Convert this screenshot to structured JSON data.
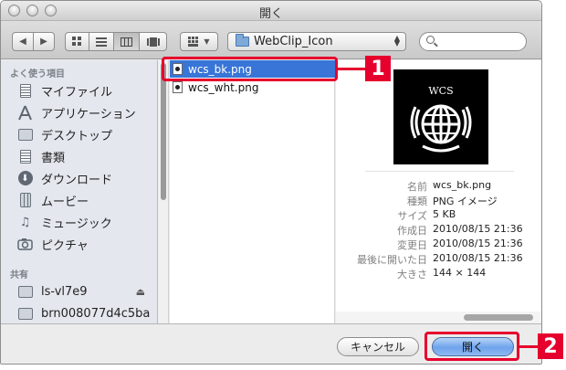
{
  "window": {
    "title": "開く"
  },
  "toolbar": {
    "back_icon": "back-arrow-icon",
    "forward_icon": "forward-arrow-icon",
    "view_modes": [
      "icon-view-icon",
      "list-view-icon",
      "column-view-icon",
      "coverflow-view-icon"
    ],
    "active_view": "column-view-icon",
    "arrange_icon": "arrange-grid-icon",
    "path": "WebClip_Icon",
    "search_placeholder": ""
  },
  "sidebar": {
    "favorites_heading": "よく使う項目",
    "favorites": [
      {
        "label": "マイファイル",
        "icon": "all-files-icon"
      },
      {
        "label": "アプリケーション",
        "icon": "applications-icon"
      },
      {
        "label": "デスクトップ",
        "icon": "desktop-icon"
      },
      {
        "label": "書類",
        "icon": "documents-icon"
      },
      {
        "label": "ダウンロード",
        "icon": "downloads-icon"
      },
      {
        "label": "ムービー",
        "icon": "movies-icon"
      },
      {
        "label": "ミュージック",
        "icon": "music-icon"
      },
      {
        "label": "ピクチャ",
        "icon": "pictures-icon"
      }
    ],
    "shared_heading": "共有",
    "shared": [
      {
        "label": "ls-vl7e9",
        "icon": "network-computer-icon",
        "eject": true
      },
      {
        "label": "brn008077d4c5ba",
        "icon": "network-computer-icon",
        "eject": false
      }
    ]
  },
  "files": [
    {
      "name": "wcs_bk.png",
      "selected": true
    },
    {
      "name": "wcs_wht.png",
      "selected": false
    }
  ],
  "preview": {
    "image_text": "WCS",
    "info": [
      {
        "key": "名前",
        "value": "wcs_bk.png"
      },
      {
        "key": "種類",
        "value": "PNG イメージ"
      },
      {
        "key": "サイズ",
        "value": "5 KB"
      },
      {
        "key": "作成日",
        "value": "2010/08/15 21:36"
      },
      {
        "key": "変更日",
        "value": "2010/08/15 21:36"
      },
      {
        "key": "最後に開いた日",
        "value": "2010/08/15 21:36"
      },
      {
        "key": "大きさ",
        "value": "144 × 144"
      }
    ]
  },
  "buttons": {
    "cancel": "キャンセル",
    "open": "開く"
  },
  "callouts": [
    {
      "number": "1",
      "target": "selected-file"
    },
    {
      "number": "2",
      "target": "open-button"
    }
  ],
  "colors": {
    "selection": "#3875d7",
    "sidebar_bg": "#e4e8ee",
    "callout": "#e6002d",
    "default_button": "#6ea3ec"
  }
}
